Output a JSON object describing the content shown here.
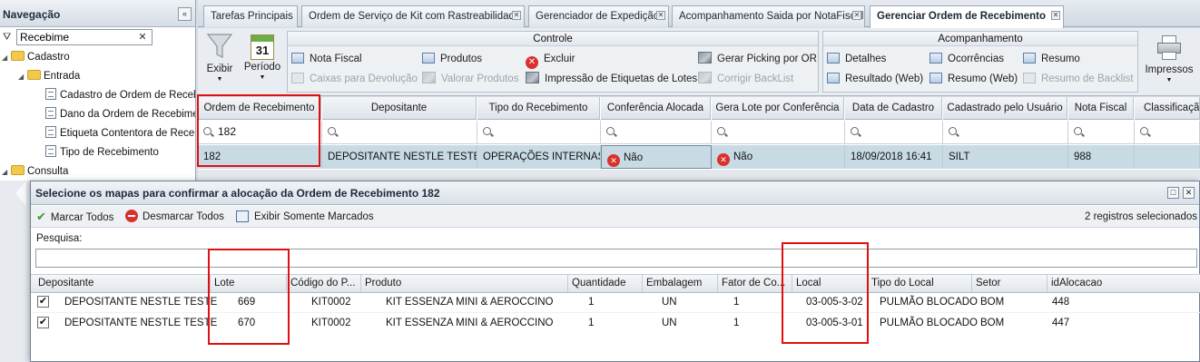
{
  "sidebar": {
    "title": "Navegação",
    "collapse_icon": "«",
    "search_value": "Recebime",
    "clear_icon": "✕",
    "tree": [
      {
        "label": "Cadastro",
        "type": "folder",
        "level": 0
      },
      {
        "label": "Entrada",
        "type": "folder",
        "level": 1
      },
      {
        "label": "Cadastro de Ordem de Recebimento",
        "type": "page",
        "level": 2
      },
      {
        "label": "Dano da Ordem de Recebimento",
        "type": "page",
        "level": 2
      },
      {
        "label": "Etiqueta Contentora de Recebimento",
        "type": "page",
        "level": 2
      },
      {
        "label": "Tipo de Recebimento",
        "type": "page",
        "level": 2
      },
      {
        "label": "Consulta",
        "type": "folder",
        "level": 0
      }
    ]
  },
  "tabs": [
    {
      "label": "Tarefas Principais",
      "closable": false
    },
    {
      "label": "Ordem de Serviço de Kit com Rastreabilidade",
      "closable": true
    },
    {
      "label": "Gerenciador de Expedição",
      "closable": true
    },
    {
      "label": "Acompanhamento Saida por NotaFiscal",
      "closable": true
    },
    {
      "label": "Gerenciar Ordem de Recebimento",
      "closable": true,
      "active": true
    }
  ],
  "toolbar": {
    "exibir": "Exibir",
    "periodo": "Período",
    "calendar_day": "31",
    "controle_title": "Controle",
    "controle": {
      "nota_fiscal": "Nota Fiscal",
      "produtos": "Produtos",
      "excluir": "Excluir",
      "gerar_picking": "Gerar Picking por OR",
      "caixas_devolucao": "Caixas para Devolução",
      "valorar_produtos": "Valorar Produtos",
      "impressao_etiquetas": "Impressão de Etiquetas de Lotes",
      "corrigir_backlist": "Corrigir BackList"
    },
    "acompanhamento_title": "Acompanhamento",
    "acompanhamento": {
      "detalhes": "Detalhes",
      "ocorrencias": "Ocorrências",
      "resumo": "Resumo",
      "resultado_web": "Resultado (Web)",
      "resumo_web": "Resumo (Web)",
      "resumo_backlist": "Resumo de Backlist"
    },
    "impressos": "Impressos"
  },
  "grid": {
    "headers": [
      "Ordem de Recebimento",
      "Depositante",
      "Tipo do Recebimento",
      "Conferência Alocada",
      "Gera Lote por Conferência",
      "Data de Cadastro",
      "Cadastrado pelo Usuário",
      "Nota Fiscal",
      "Classificação"
    ],
    "filter_value": "182",
    "row": {
      "ordem": "182",
      "depositante": "DEPOSITANTE NESTLE TESTE",
      "tipo": "OPERAÇÕES INTERNAS",
      "conferencia_alocada": "Não",
      "gera_lote": "Não",
      "data_cadastro": "18/09/2018 16:41",
      "usuario": "SILT",
      "nota_fiscal": "988",
      "classificacao": ""
    }
  },
  "dialog": {
    "title": "Selecione os mapas para confirmar a alocação da Ordem de Recebimento 182",
    "marcar_todos": "Marcar Todos",
    "desmarcar_todos": "Desmarcar Todos",
    "exibir_marcados": "Exibir Somente Marcados",
    "selected_count": "2 registros selecionados",
    "search_label": "Pesquisa:",
    "search_value": "",
    "columns": [
      "Depositante",
      "Lote",
      "Código do P...",
      "Produto",
      "Quantidade",
      "Embalagem",
      "Fator de Co...",
      "Local",
      "Tipo do Local",
      "Setor",
      "idAlocacao"
    ],
    "rows": [
      {
        "checked": true,
        "depositante": "DEPOSITANTE NESTLE TESTE",
        "lote": "669",
        "codigo": "KIT0002",
        "produto": "KIT ESSENZA MINI & AEROCCINO",
        "quantidade": "1",
        "embalagem": "UN",
        "fator": "1",
        "local": "03-005-3-02",
        "tipo_local": "PULMÃO BLOCADO",
        "setor": "BOM",
        "id_alocacao": "448"
      },
      {
        "checked": true,
        "depositante": "DEPOSITANTE NESTLE TESTE",
        "lote": "670",
        "codigo": "KIT0002",
        "produto": "KIT ESSENZA MINI & AEROCCINO",
        "quantidade": "1",
        "embalagem": "UN",
        "fator": "1",
        "local": "03-005-3-01",
        "tipo_local": "PULMÃO BLOCADO",
        "setor": "BOM",
        "id_alocacao": "447"
      }
    ]
  },
  "colors": {
    "highlight_box": "#e01010",
    "selected_row": "#c8dbe4",
    "danger": "#d9322d"
  }
}
